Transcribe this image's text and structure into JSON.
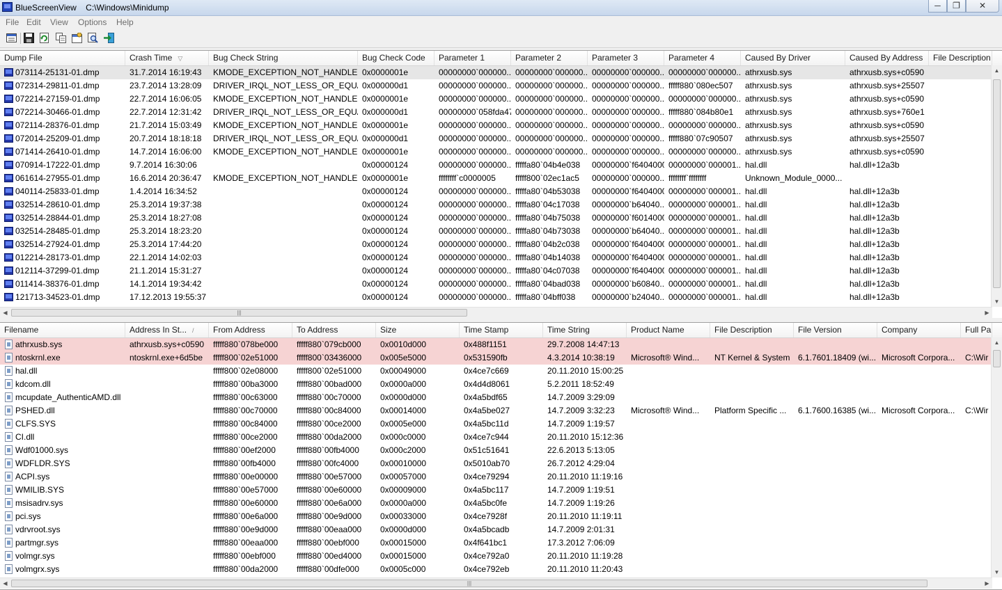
{
  "window": {
    "title": "BlueScreenView    C:\\Windows\\Minidump",
    "minimize": "─",
    "maximize": "❐",
    "close": "✕"
  },
  "menu": [
    "File",
    "Edit",
    "View",
    "Options",
    "Help"
  ],
  "toolbar": [
    {
      "name": "properties-icon",
      "glyph": "▭"
    },
    {
      "name": "save-icon",
      "glyph": "▣"
    },
    {
      "name": "refresh-icon",
      "glyph": "↻"
    },
    {
      "name": "copy-icon",
      "glyph": "⧉"
    },
    {
      "name": "html-report-icon",
      "glyph": "▦"
    },
    {
      "name": "find-icon",
      "glyph": "⌕"
    },
    {
      "name": "exit-icon",
      "glyph": "⇥"
    }
  ],
  "top_table": {
    "columns": [
      "Dump File",
      "Crash Time",
      "Bug Check String",
      "Bug Check Code",
      "Parameter 1",
      "Parameter 2",
      "Parameter 3",
      "Parameter 4",
      "Caused By Driver",
      "Caused By Address",
      "File Description"
    ],
    "sort_glyph": "▽",
    "rows": [
      [
        "073114-25131-01.dmp",
        "31.7.2014 16:19:43",
        "KMODE_EXCEPTION_NOT_HANDLED",
        "0x0000001e",
        "00000000`000000...",
        "00000000`000000...",
        "00000000`000000...",
        "00000000`000000...",
        "athrxusb.sys",
        "athrxusb.sys+c0590"
      ],
      [
        "072314-29811-01.dmp",
        "23.7.2014 13:28:09",
        "DRIVER_IRQL_NOT_LESS_OR_EQUAL",
        "0x000000d1",
        "00000000`000000...",
        "00000000`000000...",
        "00000000`000000...",
        "fffff880`080ec507",
        "athrxusb.sys",
        "athrxusb.sys+25507"
      ],
      [
        "072214-27159-01.dmp",
        "22.7.2014 16:06:05",
        "KMODE_EXCEPTION_NOT_HANDLED",
        "0x0000001e",
        "00000000`000000...",
        "00000000`000000...",
        "00000000`000000...",
        "00000000`000000...",
        "athrxusb.sys",
        "athrxusb.sys+c0590"
      ],
      [
        "072214-30466-01.dmp",
        "22.7.2014 12:31:42",
        "DRIVER_IRQL_NOT_LESS_OR_EQUAL",
        "0x000000d1",
        "00000000`058fda47",
        "00000000`000000...",
        "00000000`000000...",
        "fffff880`084b80e1",
        "athrxusb.sys",
        "athrxusb.sys+760e1"
      ],
      [
        "072114-28376-01.dmp",
        "21.7.2014 15:03:49",
        "KMODE_EXCEPTION_NOT_HANDLED",
        "0x0000001e",
        "00000000`000000...",
        "00000000`000000...",
        "00000000`000000...",
        "00000000`000000...",
        "athrxusb.sys",
        "athrxusb.sys+c0590"
      ],
      [
        "072014-25209-01.dmp",
        "20.7.2014 18:18:18",
        "DRIVER_IRQL_NOT_LESS_OR_EQUAL",
        "0x000000d1",
        "00000000`000000...",
        "00000000`000000...",
        "00000000`000000...",
        "fffff880`07c90507",
        "athrxusb.sys",
        "athrxusb.sys+25507"
      ],
      [
        "071414-26410-01.dmp",
        "14.7.2014 16:06:00",
        "KMODE_EXCEPTION_NOT_HANDLED",
        "0x0000001e",
        "00000000`000000...",
        "00000000`000000...",
        "00000000`000000...",
        "00000000`000000...",
        "athrxusb.sys",
        "athrxusb.sys+c0590"
      ],
      [
        "070914-17222-01.dmp",
        "9.7.2014 16:30:06",
        "",
        "0x00000124",
        "00000000`000000...",
        "fffffa80`04b4e038",
        "00000000`f6404000",
        "00000000`000001...",
        "hal.dll",
        "hal.dll+12a3b"
      ],
      [
        "061614-27955-01.dmp",
        "16.6.2014 20:36:47",
        "KMODE_EXCEPTION_NOT_HANDLED",
        "0x0000001e",
        "ffffffff`c0000005",
        "fffff800`02ec1ac5",
        "00000000`000000...",
        "ffffffff`ffffffff",
        "Unknown_Module_0000...",
        ""
      ],
      [
        "040114-25833-01.dmp",
        "1.4.2014 16:34:52",
        "",
        "0x00000124",
        "00000000`000000...",
        "fffffa80`04b53038",
        "00000000`f6404000",
        "00000000`000001...",
        "hal.dll",
        "hal.dll+12a3b"
      ],
      [
        "032514-28610-01.dmp",
        "25.3.2014 19:37:38",
        "",
        "0x00000124",
        "00000000`000000...",
        "fffffa80`04c17038",
        "00000000`b64040...",
        "00000000`000001...",
        "hal.dll",
        "hal.dll+12a3b"
      ],
      [
        "032514-28844-01.dmp",
        "25.3.2014 18:27:08",
        "",
        "0x00000124",
        "00000000`000000...",
        "fffffa80`04b75038",
        "00000000`f6014000",
        "00000000`000001...",
        "hal.dll",
        "hal.dll+12a3b"
      ],
      [
        "032514-28485-01.dmp",
        "25.3.2014 18:23:20",
        "",
        "0x00000124",
        "00000000`000000...",
        "fffffa80`04b73038",
        "00000000`b64040...",
        "00000000`000001...",
        "hal.dll",
        "hal.dll+12a3b"
      ],
      [
        "032514-27924-01.dmp",
        "25.3.2014 17:44:20",
        "",
        "0x00000124",
        "00000000`000000...",
        "fffffa80`04b2c038",
        "00000000`f6404000",
        "00000000`000001...",
        "hal.dll",
        "hal.dll+12a3b"
      ],
      [
        "012214-28173-01.dmp",
        "22.1.2014 14:02:03",
        "",
        "0x00000124",
        "00000000`000000...",
        "fffffa80`04b14038",
        "00000000`f6404000",
        "00000000`000001...",
        "hal.dll",
        "hal.dll+12a3b"
      ],
      [
        "012114-37299-01.dmp",
        "21.1.2014 15:31:27",
        "",
        "0x00000124",
        "00000000`000000...",
        "fffffa80`04c07038",
        "00000000`f6404000",
        "00000000`000001...",
        "hal.dll",
        "hal.dll+12a3b"
      ],
      [
        "011414-38376-01.dmp",
        "14.1.2014 19:34:42",
        "",
        "0x00000124",
        "00000000`000000...",
        "fffffa80`04bad038",
        "00000000`b60840...",
        "00000000`000001...",
        "hal.dll",
        "hal.dll+12a3b"
      ],
      [
        "121713-34523-01.dmp",
        "17.12.2013 19:55:37",
        "",
        "0x00000124",
        "00000000`000000...",
        "fffffa80`04bff038",
        "00000000`b24040...",
        "00000000`000001...",
        "hal.dll",
        "hal.dll+12a3b"
      ]
    ]
  },
  "bottom_table": {
    "columns": [
      "Filename",
      "Address In St...",
      "From Address",
      "To Address",
      "Size",
      "Time Stamp",
      "Time String",
      "Product Name",
      "File Description",
      "File Version",
      "Company",
      "Full Pa"
    ],
    "sort_glyph": "/",
    "rows": [
      [
        "athrxusb.sys",
        "athrxusb.sys+c0590",
        "fffff880`078be000",
        "fffff880`079cb000",
        "0x0010d000",
        "0x488f1151",
        "29.7.2008 14:47:13",
        "",
        "",
        "",
        "",
        ""
      ],
      [
        "ntoskrnl.exe",
        "ntoskrnl.exe+6d5be",
        "fffff800`02e51000",
        "fffff800`03436000",
        "0x005e5000",
        "0x531590fb",
        "4.3.2014 10:38:19",
        "Microsoft® Wind...",
        "NT Kernel & System",
        "6.1.7601.18409 (wi...",
        "Microsoft Corpora...",
        "C:\\Wir"
      ],
      [
        "hal.dll",
        "",
        "fffff800`02e08000",
        "fffff800`02e51000",
        "0x00049000",
        "0x4ce7c669",
        "20.11.2010 15:00:25",
        "",
        "",
        "",
        "",
        ""
      ],
      [
        "kdcom.dll",
        "",
        "fffff880`00ba3000",
        "fffff880`00bad000",
        "0x0000a000",
        "0x4d4d8061",
        "5.2.2011 18:52:49",
        "",
        "",
        "",
        "",
        ""
      ],
      [
        "mcupdate_AuthenticAMD.dll",
        "",
        "fffff880`00c63000",
        "fffff880`00c70000",
        "0x0000d000",
        "0x4a5bdf65",
        "14.7.2009 3:29:09",
        "",
        "",
        "",
        "",
        ""
      ],
      [
        "PSHED.dll",
        "",
        "fffff880`00c70000",
        "fffff880`00c84000",
        "0x00014000",
        "0x4a5be027",
        "14.7.2009 3:32:23",
        "Microsoft® Wind...",
        "Platform Specific ...",
        "6.1.7600.16385 (wi...",
        "Microsoft Corpora...",
        "C:\\Wir"
      ],
      [
        "CLFS.SYS",
        "",
        "fffff880`00c84000",
        "fffff880`00ce2000",
        "0x0005e000",
        "0x4a5bc11d",
        "14.7.2009 1:19:57",
        "",
        "",
        "",
        "",
        ""
      ],
      [
        "CI.dll",
        "",
        "fffff880`00ce2000",
        "fffff880`00da2000",
        "0x000c0000",
        "0x4ce7c944",
        "20.11.2010 15:12:36",
        "",
        "",
        "",
        "",
        ""
      ],
      [
        "Wdf01000.sys",
        "",
        "fffff880`00ef2000",
        "fffff880`00fb4000",
        "0x000c2000",
        "0x51c51641",
        "22.6.2013 5:13:05",
        "",
        "",
        "",
        "",
        ""
      ],
      [
        "WDFLDR.SYS",
        "",
        "fffff880`00fb4000",
        "fffff880`00fc4000",
        "0x00010000",
        "0x5010ab70",
        "26.7.2012 4:29:04",
        "",
        "",
        "",
        "",
        ""
      ],
      [
        "ACPI.sys",
        "",
        "fffff880`00e00000",
        "fffff880`00e57000",
        "0x00057000",
        "0x4ce79294",
        "20.11.2010 11:19:16",
        "",
        "",
        "",
        "",
        ""
      ],
      [
        "WMILIB.SYS",
        "",
        "fffff880`00e57000",
        "fffff880`00e60000",
        "0x00009000",
        "0x4a5bc117",
        "14.7.2009 1:19:51",
        "",
        "",
        "",
        "",
        ""
      ],
      [
        "msisadrv.sys",
        "",
        "fffff880`00e60000",
        "fffff880`00e6a000",
        "0x0000a000",
        "0x4a5bc0fe",
        "14.7.2009 1:19:26",
        "",
        "",
        "",
        "",
        ""
      ],
      [
        "pci.sys",
        "",
        "fffff880`00e6a000",
        "fffff880`00e9d000",
        "0x00033000",
        "0x4ce7928f",
        "20.11.2010 11:19:11",
        "",
        "",
        "",
        "",
        ""
      ],
      [
        "vdrvroot.sys",
        "",
        "fffff880`00e9d000",
        "fffff880`00eaa000",
        "0x0000d000",
        "0x4a5bcadb",
        "14.7.2009 2:01:31",
        "",
        "",
        "",
        "",
        ""
      ],
      [
        "partmgr.sys",
        "",
        "fffff880`00eaa000",
        "fffff880`00ebf000",
        "0x00015000",
        "0x4f641bc1",
        "17.3.2012 7:06:09",
        "",
        "",
        "",
        "",
        ""
      ],
      [
        "volmgr.sys",
        "",
        "fffff880`00ebf000",
        "fffff880`00ed4000",
        "0x00015000",
        "0x4ce792a0",
        "20.11.2010 11:19:28",
        "",
        "",
        "",
        "",
        ""
      ],
      [
        "volmgrx.sys",
        "",
        "fffff880`00da2000",
        "fffff880`00dfe000",
        "0x0005c000",
        "0x4ce792eb",
        "20.11.2010 11:20:43",
        "",
        "",
        "",
        "",
        ""
      ]
    ]
  },
  "colors": {
    "selected_row": "#e6e6e6",
    "highlight_row": "#f6d3d3",
    "dump_icon": "#2437a8"
  },
  "scroll_grip": "|||"
}
